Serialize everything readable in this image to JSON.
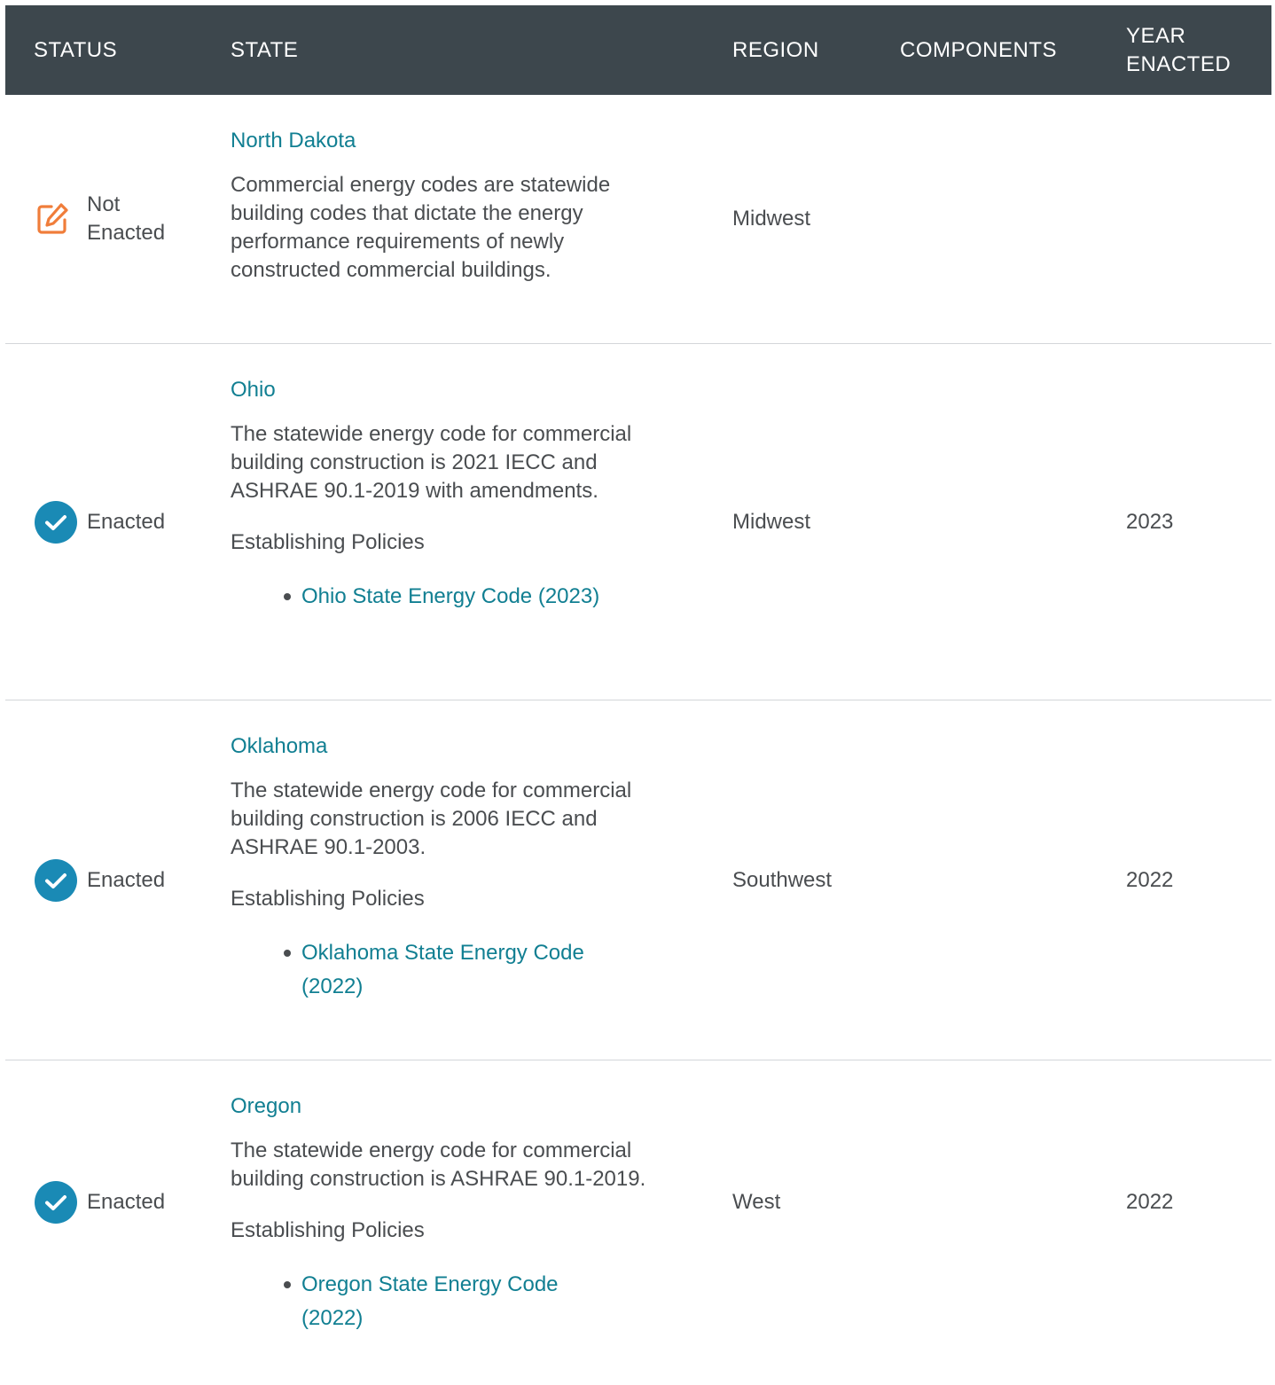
{
  "table": {
    "headers": {
      "status": "STATUS",
      "state": "STATE",
      "region": "REGION",
      "components": "COMPONENTS",
      "year_line1": "YEAR",
      "year_line2": "ENACTED"
    },
    "rows": [
      {
        "status_icon": "edit-pencil-icon",
        "status_line1": "Not",
        "status_line2": "Enacted",
        "state": "North Dakota",
        "description": "Commercial energy codes are statewide building codes that dictate the energy performance requirements of newly constructed commercial buildings.",
        "region": "Midwest",
        "components": "",
        "year": ""
      },
      {
        "status_icon": "check-circle-icon",
        "status": "Enacted",
        "state": "Ohio",
        "description": "The statewide energy code for commercial building construction is 2021 IECC and ASHRAE 90.1-2019 with amendments.",
        "policies_label": "Establishing Policies",
        "policy": "Ohio State Energy Code (2023)",
        "region": "Midwest",
        "components": "",
        "year": "2023"
      },
      {
        "status_icon": "check-circle-icon",
        "status": "Enacted",
        "state": "Oklahoma",
        "description": "The statewide energy code for commercial building construction is 2006 IECC and ASHRAE 90.1-2003.",
        "policies_label": "Establishing Policies",
        "policy": "Oklahoma State Energy Code (2022)",
        "region": "Southwest",
        "components": "",
        "year": "2022"
      },
      {
        "status_icon": "check-circle-icon",
        "status": "Enacted",
        "state": "Oregon",
        "description": "The statewide energy code for commercial building construction is ASHRAE 90.1-2019.",
        "policies_label": "Establishing Policies",
        "policy": "Oregon State Energy Code (2022)",
        "region": "West",
        "components": "",
        "year": "2022"
      }
    ]
  },
  "colors": {
    "header_bg": "#3d474d",
    "link": "#117f92",
    "check_icon": "#1a8ab5",
    "pencil_icon": "#f07d3a",
    "text": "#4a4d50",
    "divider": "#d3d6d9"
  }
}
